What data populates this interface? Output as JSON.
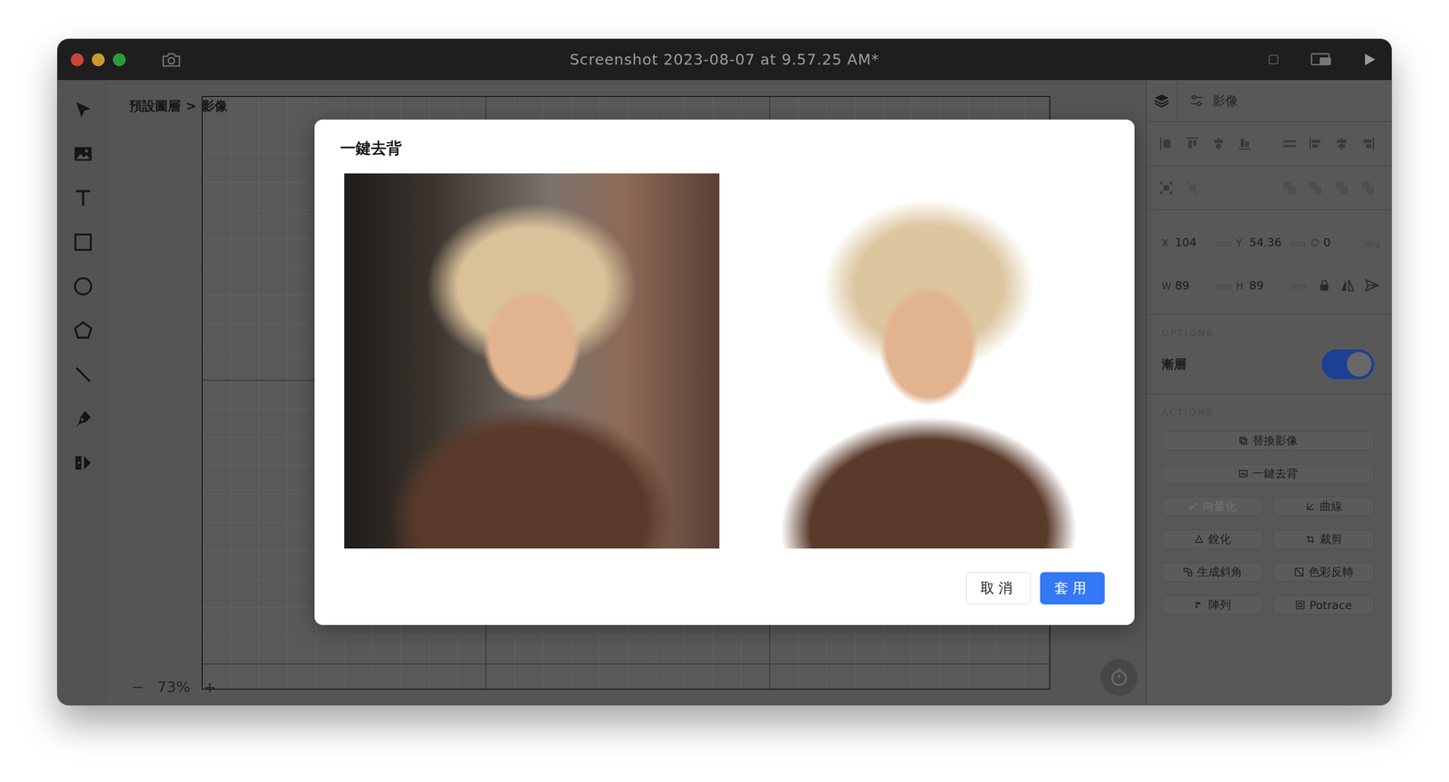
{
  "window": {
    "title": "Screenshot 2023-08-07 at 9.57.25 AM*"
  },
  "canvas": {
    "breadcrumb": [
      "預設圖層",
      "影像"
    ],
    "breadcrumb_separator": ">",
    "zoom": {
      "minus": "−",
      "value": "73%",
      "plus": "+"
    }
  },
  "inspector": {
    "title": "影像",
    "layout_tools": [
      [
        {
          "disabled": false
        },
        {
          "disabled": false
        },
        {
          "disabled": false
        },
        {
          "disabled": false
        },
        {
          "disabled": false
        },
        {
          "disabled": false
        },
        {
          "disabled": false
        },
        {
          "disabled": false
        }
      ],
      [
        {
          "disabled": false
        },
        {
          "disabled": true
        },
        {
          "disabled": true
        },
        {
          "disabled": true
        },
        {
          "disabled": true
        },
        {
          "disabled": true
        }
      ]
    ],
    "position": [
      {
        "kind": "axis",
        "label": "X",
        "value": "104",
        "unit": "mm"
      },
      {
        "kind": "axis",
        "label": "Y",
        "value": "54.36",
        "unit": "mm"
      },
      {
        "kind": "angle",
        "value": "0",
        "unit": "deg"
      }
    ],
    "size": [
      {
        "label": "W",
        "value": "89",
        "unit": "mm"
      },
      {
        "label": "H",
        "value": "89",
        "unit": "mm"
      }
    ],
    "options": {
      "heading": "OPTIONS",
      "toggles": [
        {
          "label": "漸層",
          "on": true
        }
      ]
    },
    "actions": {
      "heading": "ACTIONS",
      "primary": [
        {
          "label": "替換影像",
          "disabled": false
        },
        {
          "label": "一鍵去背",
          "disabled": false
        }
      ],
      "grid": [
        {
          "label": "向量化",
          "disabled": true
        },
        {
          "label": "曲線",
          "disabled": false
        },
        {
          "label": "銳化",
          "disabled": false
        },
        {
          "label": "裁剪",
          "disabled": false
        },
        {
          "label": "生成斜角",
          "disabled": false
        },
        {
          "label": "色彩反轉",
          "disabled": false
        },
        {
          "label": "陣列",
          "disabled": false
        },
        {
          "label": "Potrace",
          "disabled": false
        }
      ]
    }
  },
  "dialog": {
    "title": "一鍵去背",
    "buttons": [
      {
        "label": "取消",
        "primary": false
      },
      {
        "label": "套用",
        "primary": true
      }
    ]
  }
}
